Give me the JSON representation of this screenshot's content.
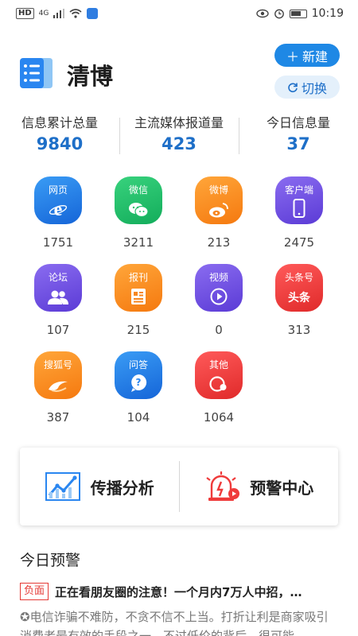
{
  "status_bar": {
    "hd": "HD",
    "signal": "4G",
    "time": "10:19"
  },
  "header": {
    "brand": "清博",
    "new_button": "新建",
    "switch_button": "切换"
  },
  "stats": [
    {
      "label": "信息累计总量",
      "value": "9840"
    },
    {
      "label": "主流媒体报道量",
      "value": "423"
    },
    {
      "label": "今日信息量",
      "value": "37"
    }
  ],
  "categories": [
    {
      "name": "网页",
      "count": "1751",
      "icon": "ie-icon",
      "color": "#2a86f0"
    },
    {
      "name": "微信",
      "count": "3211",
      "icon": "wechat-icon",
      "color": "#1fbf69"
    },
    {
      "name": "微博",
      "count": "213",
      "icon": "weibo-icon",
      "color": "#f7861f"
    },
    {
      "name": "客户端",
      "count": "2475",
      "icon": "phone-icon",
      "color": "#6b4be0"
    },
    {
      "name": "论坛",
      "count": "107",
      "icon": "users-icon",
      "color": "#6b4be0"
    },
    {
      "name": "报刊",
      "count": "215",
      "icon": "newspaper-icon",
      "color": "#f7861f"
    },
    {
      "name": "视频",
      "count": "0",
      "icon": "play-icon",
      "color": "#6b4be0"
    },
    {
      "name": "头条号",
      "count": "313",
      "icon": "toutiao-icon",
      "glyph_text": "头条",
      "color": "#ef3b3b"
    },
    {
      "name": "搜狐号",
      "count": "387",
      "icon": "sohu-icon",
      "color": "#f7861f"
    },
    {
      "name": "问答",
      "count": "104",
      "icon": "question-icon",
      "color": "#2a86f0"
    },
    {
      "name": "其他",
      "count": "1064",
      "icon": "other-icon",
      "color": "#ef3b3b"
    }
  ],
  "analysis_card": {
    "spread_label": "传播分析",
    "warning_label": "预警中心"
  },
  "today_warnings": {
    "title": "今日预警",
    "items": [
      {
        "tag": "负面",
        "title": "正在看朋友圈的注意！一个月内7万人中招，…",
        "body": "✪电信诈骗不难防，不贪不信不上当。打折让利是商家吸引消费者最有效的手段之一，不过低价的背后，很可能…"
      }
    ]
  }
}
